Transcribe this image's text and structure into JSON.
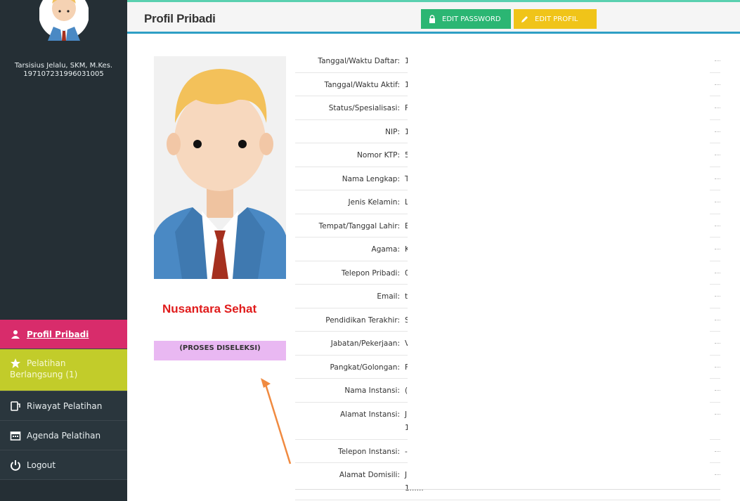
{
  "user": {
    "name": "Tarsisius Jelalu, SKM, M.Kes.",
    "nip": "197107231996031005"
  },
  "menu": {
    "profil": "Profil Pribadi",
    "berlangsung_line1": "Pelatihan",
    "berlangsung_line2": "Berlangsung (1)",
    "riwayat": "Riwayat Pelatihan",
    "agenda": "Agenda Pelatihan",
    "logout": "Logout"
  },
  "header": {
    "title": "Profil Pribadi",
    "edit_password": "EDIT PASSWORD",
    "edit_profil": "EDIT PROFIL"
  },
  "profile": {
    "status_badge": "(PROSES DISELEKSI)",
    "overlay_label": "Nusantara Sehat"
  },
  "fields": [
    {
      "label": "Tanggal/Waktu Daftar:",
      "value": "1"
    },
    {
      "label": "Tanggal/Waktu Aktif:",
      "value": "1"
    },
    {
      "label": "Status/Spesialisasi:",
      "value": "F"
    },
    {
      "label": "NIP:",
      "value": "1"
    },
    {
      "label": "Nomor KTP:",
      "value": "5"
    },
    {
      "label": "Nama Lengkap:",
      "value": "T"
    },
    {
      "label": "Jenis Kelamin:",
      "value": "L"
    },
    {
      "label": "Tempat/Tanggal Lahir:",
      "value": "E"
    },
    {
      "label": "Agama:",
      "value": "K"
    },
    {
      "label": "Telepon Pribadi:",
      "value": "0"
    },
    {
      "label": "Email:",
      "value": "t"
    },
    {
      "label": "Pendidikan Terakhir:",
      "value": "S"
    },
    {
      "label": "Jabatan/Pekerjaan:",
      "value": "V"
    },
    {
      "label": "Pangkat/Golongan:",
      "value": "F"
    },
    {
      "label": "Nama Instansi:",
      "value": "("
    },
    {
      "label": "Alamat Instansi:",
      "value": "J",
      "value2": "1"
    },
    {
      "label": "Telepon Instansi:",
      "value": "-"
    },
    {
      "label": "Alamat Domisili:",
      "value": "J",
      "value2": "1......"
    }
  ],
  "colors": {
    "sidebar": "#252f35",
    "active": "#d82c6b",
    "berlangsung": "#c2cc2a",
    "pass_button": "#2bb673",
    "edit_button": "#f0c419",
    "status_badge": "#e9b8f2",
    "overlay_text": "#e01b1b",
    "arrow": "#f08a40"
  }
}
